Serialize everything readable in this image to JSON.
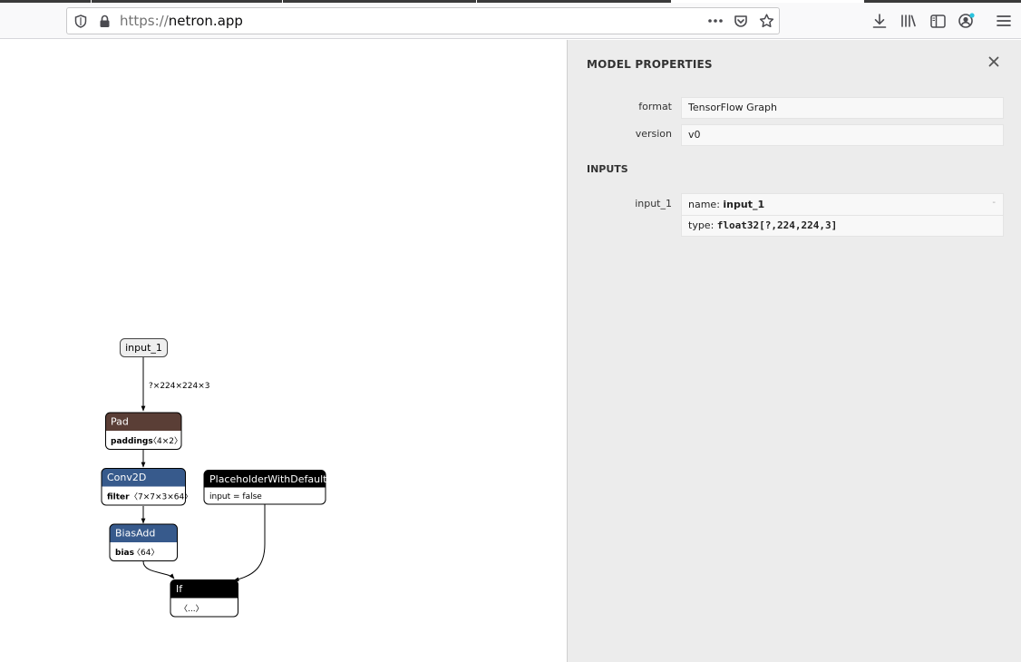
{
  "browser": {
    "url_scheme": "https://",
    "url_host": "netron.app",
    "icons": [
      "shield-icon",
      "lock-icon",
      "more-actions-icon",
      "pocket-icon",
      "bookmark-star-icon",
      "downloads-icon",
      "library-icon",
      "sidebar-icon",
      "account-icon",
      "menu-icon"
    ]
  },
  "graph": {
    "nodes": {
      "input_1": {
        "label": "input_1"
      },
      "pad": {
        "title": "Pad",
        "attr_name": "paddings",
        "attr_value": "〈4×2〉"
      },
      "conv2d": {
        "title": "Conv2D",
        "attr_name": "filter",
        "attr_value": "〈7×7×3×64〉"
      },
      "biasadd": {
        "title": "BiasAdd",
        "attr_name": "bias",
        "attr_value": "〈64〉"
      },
      "placeholder": {
        "title": "PlaceholderWithDefault",
        "attr_text": "input = false"
      },
      "if": {
        "title": "If",
        "attr_text": "〈...〉"
      }
    },
    "edges": {
      "input_to_pad_label": "?×224×224×3"
    },
    "colors": {
      "pad_header": "#5a3e36",
      "layer_header": "#375a8c",
      "control_header": "#000000",
      "edge": "#000000"
    }
  },
  "sidebar": {
    "title": "MODEL PROPERTIES",
    "close_icon": "close-icon",
    "properties": [
      {
        "name": "format",
        "value": "TensorFlow Graph"
      },
      {
        "name": "version",
        "value": "v0"
      }
    ],
    "inputs_header": "INPUTS",
    "inputs": [
      {
        "name": "input_1",
        "name_label": "name:",
        "name_value": "input_1",
        "type_label": "type:",
        "type_value": "float32[?,224,224,3]",
        "expand_symbol": "-"
      }
    ]
  }
}
